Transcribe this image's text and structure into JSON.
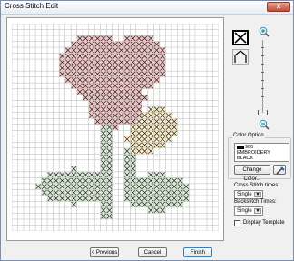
{
  "window": {
    "title": "Cross Stitch Edit",
    "close_glyph": "x"
  },
  "grid": {
    "cols": 35,
    "rows": 35,
    "line_color": "#b8b8b8",
    "cross_color": "#222222"
  },
  "palette": {
    "red": "#f6c6c6",
    "yellow": "#fff1c8",
    "green": "#dcefd8"
  },
  "color_option": {
    "title": "Color Option",
    "code": "900",
    "line2": "EMBROIDERY",
    "line3": "BLACK",
    "change_label": "Change Color...",
    "swatch": "#000000"
  },
  "cross_stitch": {
    "label": "Cross Stitch times:",
    "value": "Single"
  },
  "backstitch": {
    "label": "Backstitch Times:",
    "value": "Single"
  },
  "display_template": {
    "label": "Display Template",
    "checked": false
  },
  "footer": {
    "previous": "< Previous",
    "cancel": "Cancel",
    "finish": "Finish"
  },
  "icons": {
    "cross": "cross-stitch-tool-icon",
    "house": "backstitch-tool-icon",
    "zoom_in": "zoom-in-icon",
    "zoom_out": "zoom-out-icon",
    "eyedropper": "eyedropper-icon"
  }
}
